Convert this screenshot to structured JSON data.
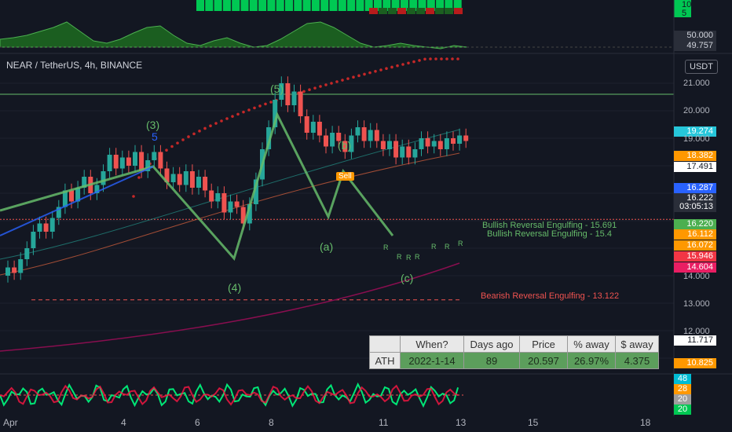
{
  "chart_title": "NEAR / TetherUS, 4h, BINANCE",
  "currency_button": "USDT",
  "colors": {
    "up": "#26a69a",
    "down": "#ef5350",
    "bg": "#131722",
    "wave": "#66bb6a",
    "green": "#4caf50",
    "red": "#ef5350",
    "orange": "#ff9800",
    "pink": "#e91e63"
  },
  "top_panel_tags": [
    "10",
    "5"
  ],
  "osc_panel_tags": [
    "50.000",
    "49.757"
  ],
  "price_tags": [
    {
      "value": "21.000",
      "type": "axis"
    },
    {
      "value": "20.000",
      "type": "axis"
    },
    {
      "value": "19.274",
      "color": "#26c6da"
    },
    {
      "value": "19.000",
      "type": "axis"
    },
    {
      "value": "18.382",
      "color": "#ff9800"
    },
    {
      "value": "17.491",
      "color": "#ffffff"
    },
    {
      "value": "16.287",
      "color": "#2962ff"
    },
    {
      "value": "16.222",
      "color": "#2a2e39"
    },
    {
      "value": "03:05:13",
      "color": "#2a2e39"
    },
    {
      "value": "16.220",
      "color": "#4caf50"
    },
    {
      "value": "16.112",
      "color": "#ff9800"
    },
    {
      "value": "16.072",
      "color": "#ff9800"
    },
    {
      "value": "15.946",
      "color": "#f23645"
    },
    {
      "value": "14.604",
      "color": "#e91e63"
    },
    {
      "value": "14.000",
      "type": "axis"
    },
    {
      "value": "13.000",
      "type": "axis"
    },
    {
      "value": "12.000",
      "type": "axis"
    },
    {
      "value": "11.717",
      "color": "#ffffff"
    },
    {
      "value": "10.825",
      "color": "#ff9800"
    }
  ],
  "bottom_tags": [
    "48",
    "28",
    "20",
    "20"
  ],
  "x_labels": [
    "Apr",
    "4",
    "6",
    "8",
    "11",
    "13",
    "15",
    "18"
  ],
  "wave_labels": {
    "w3": "(3)",
    "w3b": "5",
    "w5": "(5)",
    "w4": "(4)",
    "wa": "(a)",
    "wb": "(b)",
    "wc": "(c)"
  },
  "annotations": {
    "bull1": "Bullish Reversal Engulfing - 15.691",
    "bull2": "Bullish Reversal Engulfing - 15.4",
    "bear": "Bearish Reversal Engulfing - 13.122",
    "sell": "Sell"
  },
  "ath_table": {
    "headers": [
      "",
      "When?",
      "Days ago",
      "Price",
      "% away",
      "$ away"
    ],
    "row": [
      "ATH",
      "2022-1-14",
      "89",
      "20.597",
      "26.97%",
      "4.375"
    ]
  },
  "chart_data": {
    "type": "candlestick",
    "title": "NEAR / TetherUS, 4h, BINANCE",
    "x_ticks": [
      "Apr",
      "4",
      "6",
      "8",
      "11",
      "13",
      "15",
      "18"
    ],
    "y_ticks": [
      10,
      11,
      12,
      13,
      14,
      15,
      16,
      17,
      18,
      19,
      20,
      21
    ],
    "y_range": [
      10.6,
      21.8
    ],
    "wave_path": [
      {
        "x": "Apr 1",
        "y": 15.8
      },
      {
        "x": "Apr 4",
        "y": 17.5
      },
      {
        "x": "Apr 6.5",
        "y": 14.6
      },
      {
        "x": "Apr 8",
        "y": 19.8
      },
      {
        "x": "Apr 10",
        "y": 15.8
      },
      {
        "x": "Apr 10.5",
        "y": 17.3
      },
      {
        "x": "Apr 11.5",
        "y": 15.3
      }
    ],
    "levels": {
      "horizontal_green": 20.6,
      "horizontal_red": 16.0,
      "bearish_dashed": 13.122
    }
  }
}
